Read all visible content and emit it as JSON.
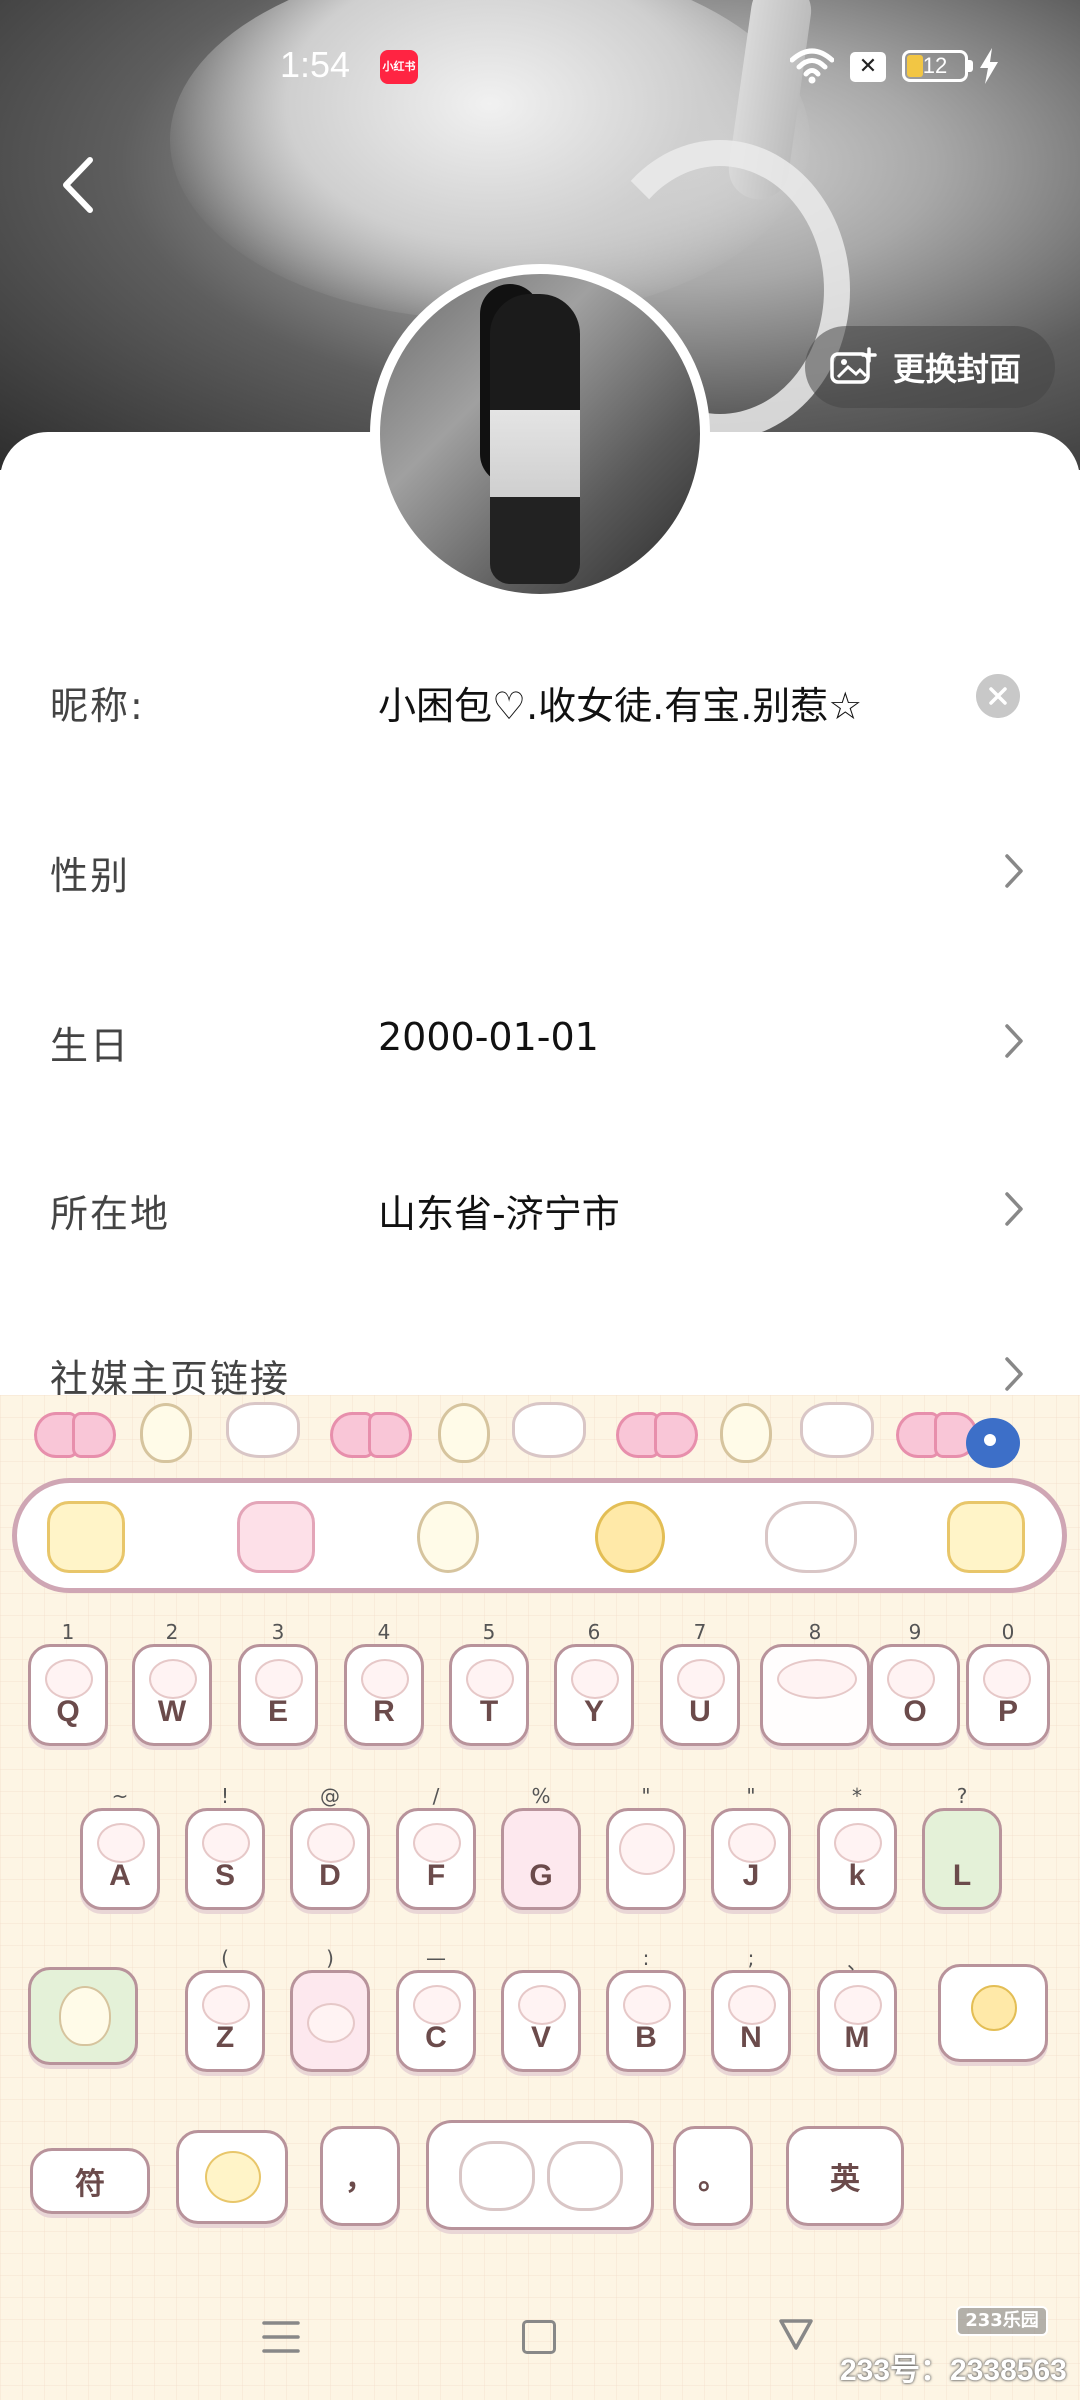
{
  "status_bar": {
    "time": "1:54",
    "app_badge": "小红书",
    "battery_level": "12"
  },
  "header": {
    "change_cover_label": "更换封面"
  },
  "profile_fields": [
    {
      "label": "昵称:",
      "value": "小困包♡.收女徒.有宝.别惹☆"
    },
    {
      "label": "性别",
      "value": ""
    },
    {
      "label": "生日",
      "value": "2000-01-01"
    },
    {
      "label": "所在地",
      "value": "山东省-济宁市"
    },
    {
      "label": "社媒主页链接",
      "value": ""
    }
  ],
  "keyboard": {
    "row1": [
      {
        "hint": "1",
        "letter": "Q"
      },
      {
        "hint": "2",
        "letter": "W"
      },
      {
        "hint": "3",
        "letter": "E"
      },
      {
        "hint": "4",
        "letter": "R"
      },
      {
        "hint": "5",
        "letter": "T"
      },
      {
        "hint": "6",
        "letter": "Y"
      },
      {
        "hint": "7",
        "letter": "U"
      },
      {
        "hint": "8",
        "letter": ""
      },
      {
        "hint": "9",
        "letter": "O"
      },
      {
        "hint": "0",
        "letter": "P"
      }
    ],
    "row2": [
      {
        "hint": "~",
        "letter": "A"
      },
      {
        "hint": "!",
        "letter": "S"
      },
      {
        "hint": "@",
        "letter": "D"
      },
      {
        "hint": "/",
        "letter": "F"
      },
      {
        "hint": "%",
        "letter": "G"
      },
      {
        "hint": "\"",
        "letter": ""
      },
      {
        "hint": "\"",
        "letter": "J"
      },
      {
        "hint": "*",
        "letter": "k"
      },
      {
        "hint": "?",
        "letter": "L"
      }
    ],
    "row3": [
      {
        "hint": "(",
        "letter": "Z"
      },
      {
        "hint": ")",
        "letter": ""
      },
      {
        "hint": "—",
        "letter": "C"
      },
      {
        "hint": "",
        "letter": "V"
      },
      {
        "hint": ":",
        "letter": "B"
      },
      {
        "hint": ";",
        "letter": "N"
      },
      {
        "hint": "、",
        "letter": "M"
      }
    ],
    "symbol_key": "符",
    "comma_key": "，",
    "period_key": "。",
    "lang_key": "英"
  },
  "watermark": {
    "badge": "233乐园",
    "id_text": "233号：2338563"
  }
}
